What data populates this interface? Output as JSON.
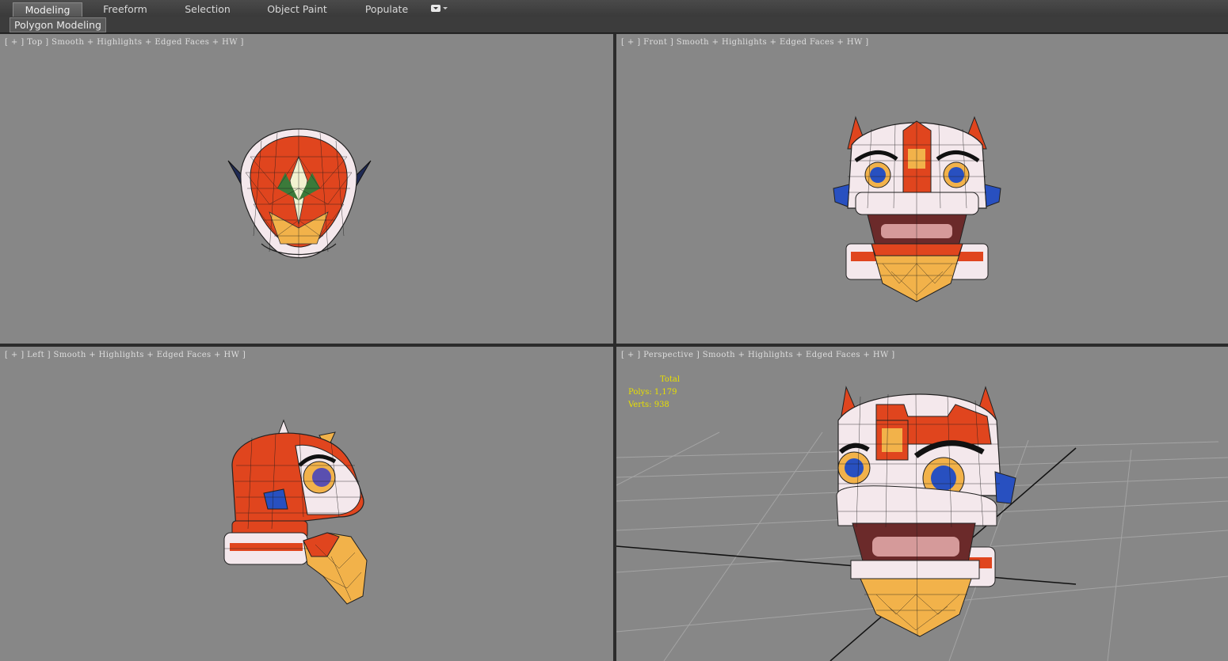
{
  "ribbon": {
    "tabs": [
      {
        "label": "Modeling",
        "active": true
      },
      {
        "label": "Freeform",
        "active": false
      },
      {
        "label": "Selection",
        "active": false
      },
      {
        "label": "Object Paint",
        "active": false
      },
      {
        "label": "Populate",
        "active": false
      }
    ],
    "dropdown_icon": "ribbon-options-dropdown-icon",
    "sub_label": "Polygon Modeling"
  },
  "viewports": {
    "top": {
      "label": "[ + ] Top ] Smooth + Highlights + Edged Faces + HW ]"
    },
    "front": {
      "label": "[ + ] Front ] Smooth + Highlights + Edged Faces + HW ]"
    },
    "left": {
      "label": "[ + ] Left ] Smooth + Highlights + Edged Faces + HW ]"
    },
    "perspective": {
      "label": "[ + ] Perspective ] Smooth + Highlights + Edged Faces + HW ]",
      "stats": {
        "header": "Total",
        "polys": "Polys: 1,179",
        "verts": "Verts: 938"
      }
    }
  },
  "colors": {
    "viewport_bg": "#878787",
    "stats_text": "#e8e000",
    "model_red": "#e0451e",
    "model_white": "#f4e8ec",
    "model_gold": "#f2b24a",
    "model_blue": "#2850c0"
  }
}
